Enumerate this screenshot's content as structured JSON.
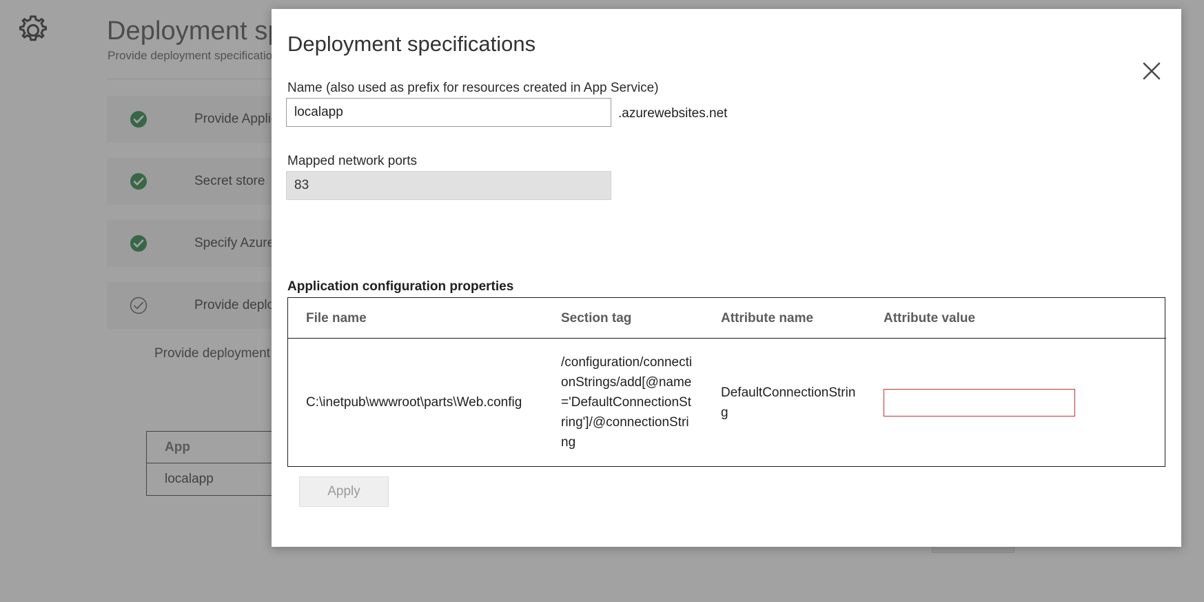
{
  "background": {
    "icon": "gear-icon",
    "title": "Deployment specifications",
    "subtitle": "Provide deployment specifications",
    "steps": [
      {
        "label": "Provide Application details",
        "state": "complete",
        "icon": "check-circle-filled-icon"
      },
      {
        "label": "Secret store",
        "state": "complete",
        "icon": "check-circle-filled-icon"
      },
      {
        "label": "Specify Azure resources",
        "state": "complete",
        "icon": "check-circle-filled-icon"
      },
      {
        "label": "Provide deployment specifications",
        "state": "current",
        "icon": "check-circle-outline-icon"
      }
    ],
    "description": "Provide deployment specifications to generate specs.",
    "table": {
      "headers": [
        "App"
      ],
      "rows": [
        [
          "localapp"
        ]
      ]
    },
    "footer_button": ""
  },
  "modal": {
    "title": "Deployment specifications",
    "close_icon": "close-icon",
    "name_field": {
      "label": "Name (also used as prefix for resources created in App Service)",
      "value": "localapp",
      "placeholder": "",
      "suffix": ".azurewebsites.net"
    },
    "ports_field": {
      "label": "Mapped network ports",
      "value": "83",
      "placeholder": "",
      "disabled": true
    },
    "properties": {
      "heading": "Application configuration properties",
      "headers": [
        "File name",
        "Section tag",
        "Attribute name",
        "Attribute value"
      ],
      "rows": [
        {
          "file_name": "C:\\inetpub\\wwwroot\\parts\\Web.config",
          "section_tag": "/configuration/connectionStrings/add[@name='DefaultConnectionString']/@connectionString",
          "attribute_name": "DefaultConnectionString",
          "attribute_value": "",
          "attribute_value_placeholder": ""
        }
      ]
    },
    "apply_label": "Apply"
  },
  "colors": {
    "accent_green": "#0f7a2e",
    "error_red": "#c2332d",
    "scrim": "rgba(90,90,90,0.56)"
  }
}
